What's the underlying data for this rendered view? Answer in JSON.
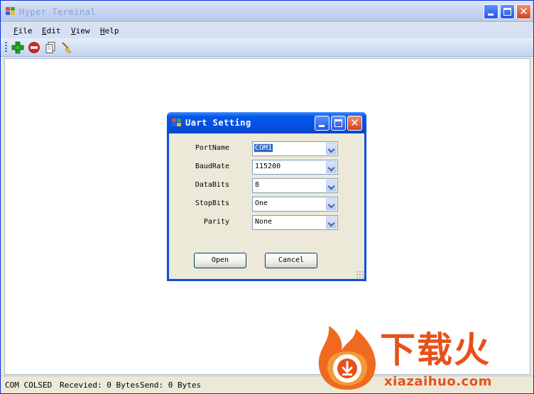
{
  "main_window": {
    "title": "Hyper Terminal",
    "menu": [
      {
        "label": "File",
        "mnemonic": "F",
        "rest": "ile"
      },
      {
        "label": "Edit",
        "mnemonic": "E",
        "rest": "dit"
      },
      {
        "label": "View",
        "mnemonic": "V",
        "rest": "iew"
      },
      {
        "label": "Help",
        "mnemonic": "H",
        "rest": "elp"
      }
    ],
    "toolbar": [
      "add-icon",
      "stop-icon",
      "copy-icon",
      "clear-icon"
    ],
    "status": {
      "connection": "COM COLSED",
      "received": "Recevied: 0 Bytes",
      "send": "Send: 0 Bytes"
    }
  },
  "dialog": {
    "title": "Uart Setting",
    "fields": [
      {
        "label": "PortName",
        "value": "COM1"
      },
      {
        "label": "BaudRate",
        "value": "115200"
      },
      {
        "label": "DataBits",
        "value": "8"
      },
      {
        "label": "StopBits",
        "value": "One"
      },
      {
        "label": "Parity",
        "value": "None"
      }
    ],
    "open_label": "Open",
    "cancel_label": "Cancel"
  },
  "watermark": {
    "brand": "下载火",
    "url": "xiazaihuo.com"
  },
  "colors": {
    "accent_blue": "#0450e4",
    "close_red": "#d1431d",
    "watermark_orange": "#e8501a"
  }
}
